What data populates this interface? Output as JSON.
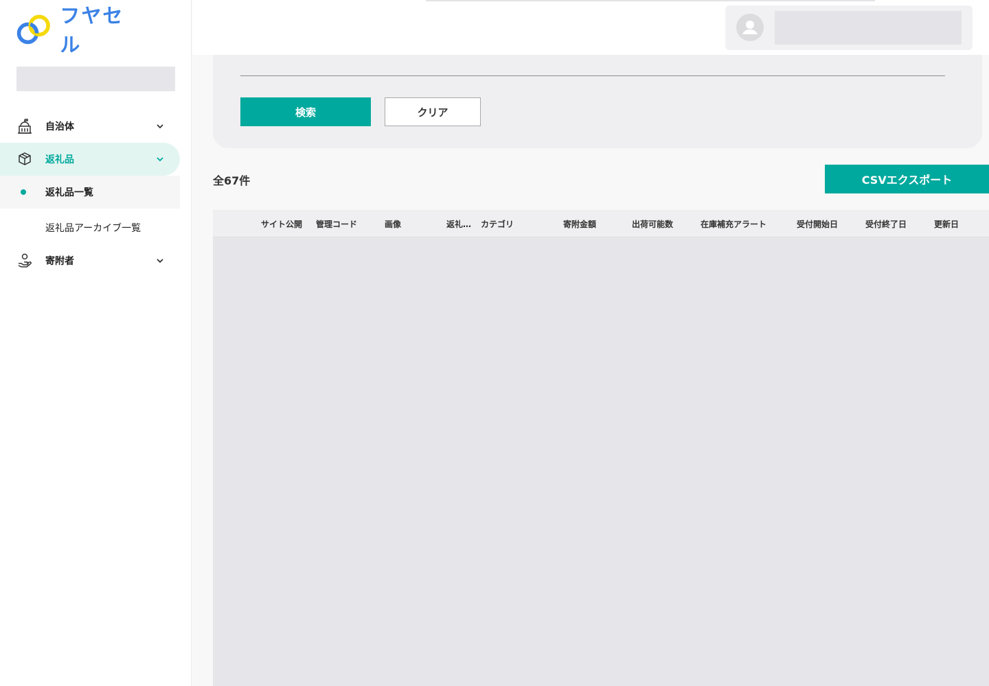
{
  "app": {
    "logo_text": "フヤセル"
  },
  "sidebar": {
    "items": [
      {
        "label": "自治体"
      },
      {
        "label": "返礼品"
      },
      {
        "label": "寄附者"
      }
    ],
    "sub_items": [
      {
        "label": "返礼品一覧"
      },
      {
        "label": "返礼品アーカイブ一覧"
      }
    ]
  },
  "search": {
    "search_label": "検索",
    "clear_label": "クリア"
  },
  "results": {
    "total": "全67件",
    "csv_label": "CSVエクスポート"
  },
  "table": {
    "columns": [
      "サイト公開",
      "管理コード",
      "画像",
      "返礼…",
      "カテゴリ",
      "寄附金額",
      "出荷可能数",
      "在庫補充アラート",
      "受付開始日",
      "受付終了日",
      "更新日"
    ]
  },
  "colors": {
    "accent": "#00a99d",
    "logo_blue": "#3b82e6",
    "logo_yellow": "#f5d90a"
  }
}
